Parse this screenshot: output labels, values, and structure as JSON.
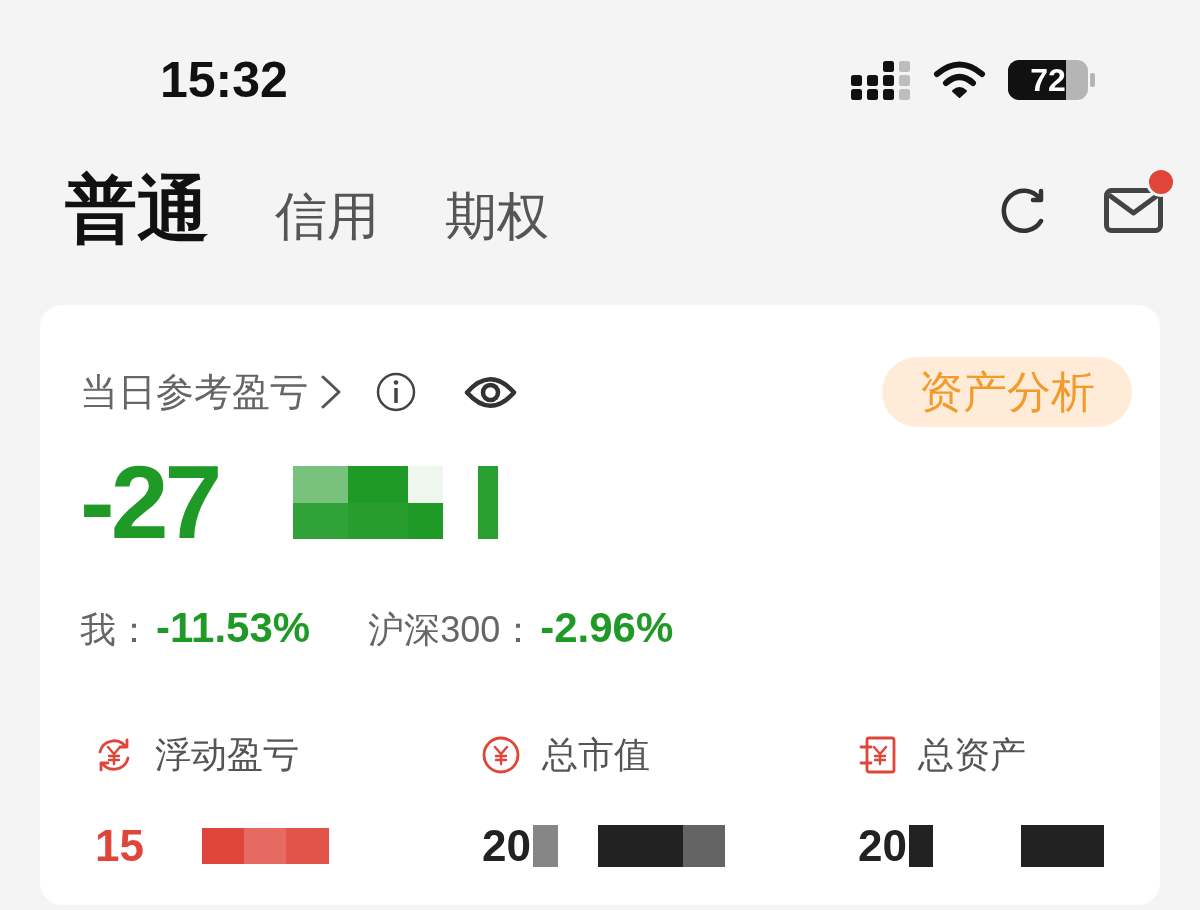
{
  "status_bar": {
    "time": "15:32",
    "battery": "72"
  },
  "header": {
    "tabs": [
      {
        "label": "普通",
        "selected": true
      },
      {
        "label": "信用",
        "selected": false
      },
      {
        "label": "期权",
        "selected": false
      }
    ],
    "mail": {
      "unread": true
    }
  },
  "summary": {
    "title": "当日参考盈亏",
    "analysis_button": "资产分析",
    "pnl": "-27",
    "comparisons": [
      {
        "label": "我：",
        "value": "-11.53%"
      },
      {
        "label": "沪深300：",
        "value": "-2.96%"
      }
    ]
  },
  "metrics": [
    {
      "kind": "floating",
      "label": "浮动盈亏",
      "value": "15",
      "color": "#e0453a"
    },
    {
      "kind": "market",
      "label": "总市值",
      "value": "20",
      "color": "#222222"
    },
    {
      "kind": "assets",
      "label": "总资产",
      "value": "20",
      "color": "#222222"
    }
  ]
}
